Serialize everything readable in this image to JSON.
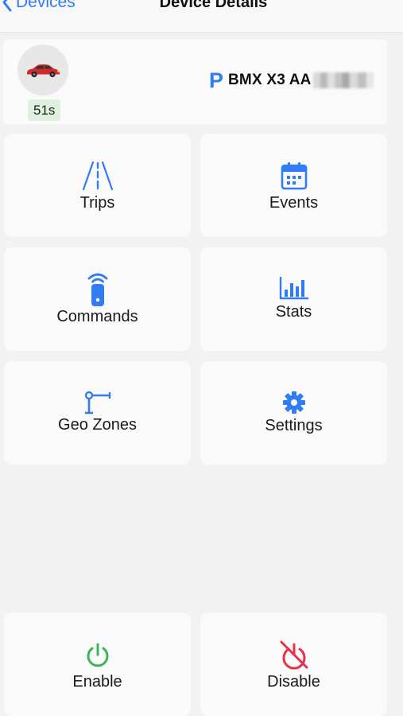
{
  "nav": {
    "back_label": "Devices",
    "title": "Device Details"
  },
  "device": {
    "timer": "51s",
    "plate_prefix": "BMX X3 AA",
    "parking_symbol": "P"
  },
  "tiles": [
    {
      "label": "Trips",
      "icon": "road-icon"
    },
    {
      "label": "Events",
      "icon": "calendar-icon"
    },
    {
      "label": "Commands",
      "icon": "remote-control-icon"
    },
    {
      "label": "Stats",
      "icon": "bar-chart-icon"
    },
    {
      "label": "Geo Zones",
      "icon": "geofence-icon"
    },
    {
      "label": "Settings",
      "icon": "gear-icon"
    }
  ],
  "actions": {
    "enable_label": "Enable",
    "disable_label": "Disable"
  },
  "colors": {
    "accent": "#2f7cf6",
    "enable": "#3cb45a",
    "disable": "#e5324a",
    "background": "#f2f2f2",
    "tile": "#fafafa"
  }
}
